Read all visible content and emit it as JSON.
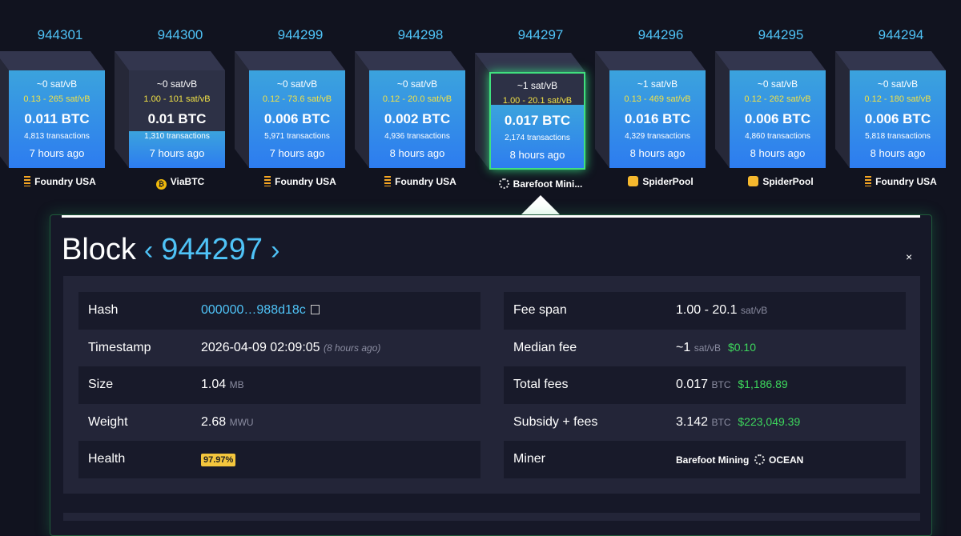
{
  "blocks": [
    {
      "height": "944301",
      "fee_median": "~0 sat/vB",
      "fee_range": "0.13 - 265 sat/vB",
      "total": "0.011 BTC",
      "tx": "4,813 transactions",
      "time": "7 hours ago",
      "miner": "Foundry USA",
      "miner_icon": "foundry-icon",
      "fill": 1.0
    },
    {
      "height": "944300",
      "fee_median": "~0 sat/vB",
      "fee_range": "1.00 - 101 sat/vB",
      "total": "0.01 BTC",
      "tx": "1,310 transactions",
      "time": "7 hours ago",
      "miner": "ViaBTC",
      "miner_icon": "viabtc-icon",
      "fill": 0.38
    },
    {
      "height": "944299",
      "fee_median": "~0 sat/vB",
      "fee_range": "0.12 - 73.6 sat/vB",
      "total": "0.006 BTC",
      "tx": "5,971 transactions",
      "time": "7 hours ago",
      "miner": "Foundry USA",
      "miner_icon": "foundry-icon",
      "fill": 1.0
    },
    {
      "height": "944298",
      "fee_median": "~0 sat/vB",
      "fee_range": "0.12 - 20.0 sat/vB",
      "total": "0.002 BTC",
      "tx": "4,936 transactions",
      "time": "8 hours ago",
      "miner": "Foundry USA",
      "miner_icon": "foundry-icon",
      "fill": 1.0
    },
    {
      "height": "944297",
      "fee_median": "~1 sat/vB",
      "fee_range": "1.00 - 20.1 sat/vB",
      "total": "0.017 BTC",
      "tx": "2,174 transactions",
      "time": "8 hours ago",
      "miner": "Barefoot Mini...",
      "miner_icon": "ocean-icon",
      "fill": 0.66,
      "selected": true
    },
    {
      "height": "944296",
      "fee_median": "~1 sat/vB",
      "fee_range": "0.13 - 469 sat/vB",
      "total": "0.016 BTC",
      "tx": "4,329 transactions",
      "time": "8 hours ago",
      "miner": "SpiderPool",
      "miner_icon": "spiderpool-icon",
      "fill": 1.0
    },
    {
      "height": "944295",
      "fee_median": "~0 sat/vB",
      "fee_range": "0.12 - 262 sat/vB",
      "total": "0.006 BTC",
      "tx": "4,860 transactions",
      "time": "8 hours ago",
      "miner": "SpiderPool",
      "miner_icon": "spiderpool-icon",
      "fill": 1.0
    },
    {
      "height": "944294",
      "fee_median": "~0 sat/vB",
      "fee_range": "0.12 - 180 sat/vB",
      "total": "0.006 BTC",
      "tx": "5,818 transactions",
      "time": "8 hours ago",
      "miner": "Foundry USA",
      "miner_icon": "foundry-icon",
      "fill": 1.0
    }
  ],
  "detail": {
    "title": "Block",
    "prev_arrow": "‹",
    "height": "944297",
    "next_arrow": "›",
    "close": "×",
    "left": {
      "hash_label": "Hash",
      "hash_value": "000000…988d18c",
      "timestamp_label": "Timestamp",
      "timestamp_value": "2026-04-09 02:09:05",
      "timestamp_ago": "(8 hours ago)",
      "size_label": "Size",
      "size_value": "1.04",
      "size_unit": "MB",
      "weight_label": "Weight",
      "weight_value": "2.68",
      "weight_unit": "MWU",
      "health_label": "Health",
      "health_value": "97.97%"
    },
    "right": {
      "feespan_label": "Fee span",
      "feespan_value": "1.00 - 20.1",
      "feespan_unit": "sat/vB",
      "median_label": "Median fee",
      "median_value": "~1",
      "median_unit": "sat/vB",
      "median_usd": "$0.10",
      "total_label": "Total fees",
      "total_value": "0.017",
      "total_unit": "BTC",
      "total_usd": "$1,186.89",
      "subsidy_label": "Subsidy + fees",
      "subsidy_value": "3.142",
      "subsidy_unit": "BTC",
      "subsidy_usd": "$223,049.39",
      "miner_label": "Miner",
      "miner_name": "Barefoot Mining",
      "miner_pool": "OCEAN"
    }
  },
  "colors": {
    "accent": "#4fc3f7",
    "selected": "#40e07e",
    "fee_range": "#f0e146",
    "usd": "#3dd65c",
    "health": "#f4c63d"
  }
}
